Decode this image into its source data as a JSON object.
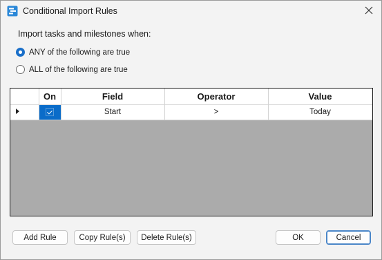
{
  "window": {
    "title": "Conditional Import Rules",
    "app_icon": "rules-list-icon",
    "close_icon": "close-icon"
  },
  "heading": "Import tasks and milestones when:",
  "match_mode": {
    "options": [
      {
        "label": "ANY of the following are true",
        "checked": true
      },
      {
        "label": "ALL of the following are true",
        "checked": false
      }
    ]
  },
  "grid": {
    "columns": [
      "On",
      "Field",
      "Operator",
      "Value"
    ],
    "rows": [
      {
        "on": true,
        "field": "Start",
        "operator": ">",
        "value": "Today",
        "current": true
      }
    ]
  },
  "buttons": {
    "add_rule": "Add Rule",
    "copy_rules": "Copy Rule(s)",
    "delete_rules": "Delete Rule(s)",
    "ok": "OK",
    "cancel": "Cancel"
  },
  "colors": {
    "accent": "#0a6cc9",
    "grid_empty": "#ababab",
    "window_bg": "#f3f3f3"
  }
}
